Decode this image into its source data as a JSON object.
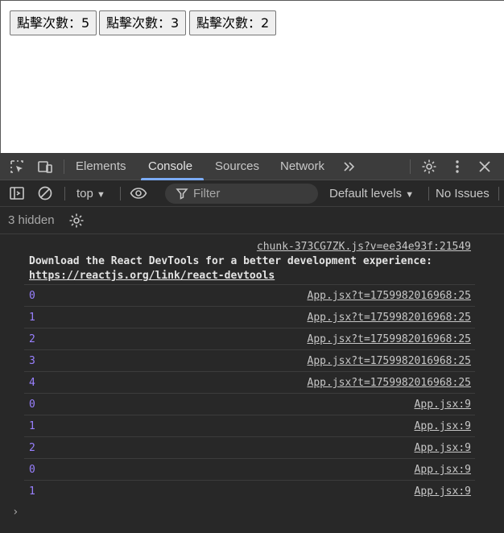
{
  "page": {
    "buttons": [
      {
        "label": "點擊次數：5"
      },
      {
        "label": "點擊次數：3"
      },
      {
        "label": "點擊次數：2"
      }
    ]
  },
  "devtools": {
    "tabs": [
      "Elements",
      "Console",
      "Sources",
      "Network"
    ],
    "active_tab": "Console",
    "more_tabs_icon": "double-chevron-right-icon",
    "toolbar": {
      "context": "top",
      "filter_placeholder": "Filter",
      "levels": "Default levels",
      "issues": "No Issues"
    },
    "hidden_count": "3 hidden",
    "accent_color": "#7cacf8",
    "number_color": "#9980ff",
    "messages": {
      "header_source": "chunk-373CG7ZK.js?v=ee34e93f:21549",
      "header_text": "Download the React DevTools for a better development experience:",
      "header_link": "https://reactjs.org/link/react-devtools",
      "rows": [
        {
          "value": "0",
          "source": "App.jsx?t=1759982016968:25"
        },
        {
          "value": "1",
          "source": "App.jsx?t=1759982016968:25"
        },
        {
          "value": "2",
          "source": "App.jsx?t=1759982016968:25"
        },
        {
          "value": "3",
          "source": "App.jsx?t=1759982016968:25"
        },
        {
          "value": "4",
          "source": "App.jsx?t=1759982016968:25"
        },
        {
          "value": "0",
          "source": "App.jsx:9"
        },
        {
          "value": "1",
          "source": "App.jsx:9"
        },
        {
          "value": "2",
          "source": "App.jsx:9"
        },
        {
          "value": "0",
          "source": "App.jsx:9"
        },
        {
          "value": "1",
          "source": "App.jsx:9"
        }
      ]
    },
    "prompt_symbol": "›"
  }
}
